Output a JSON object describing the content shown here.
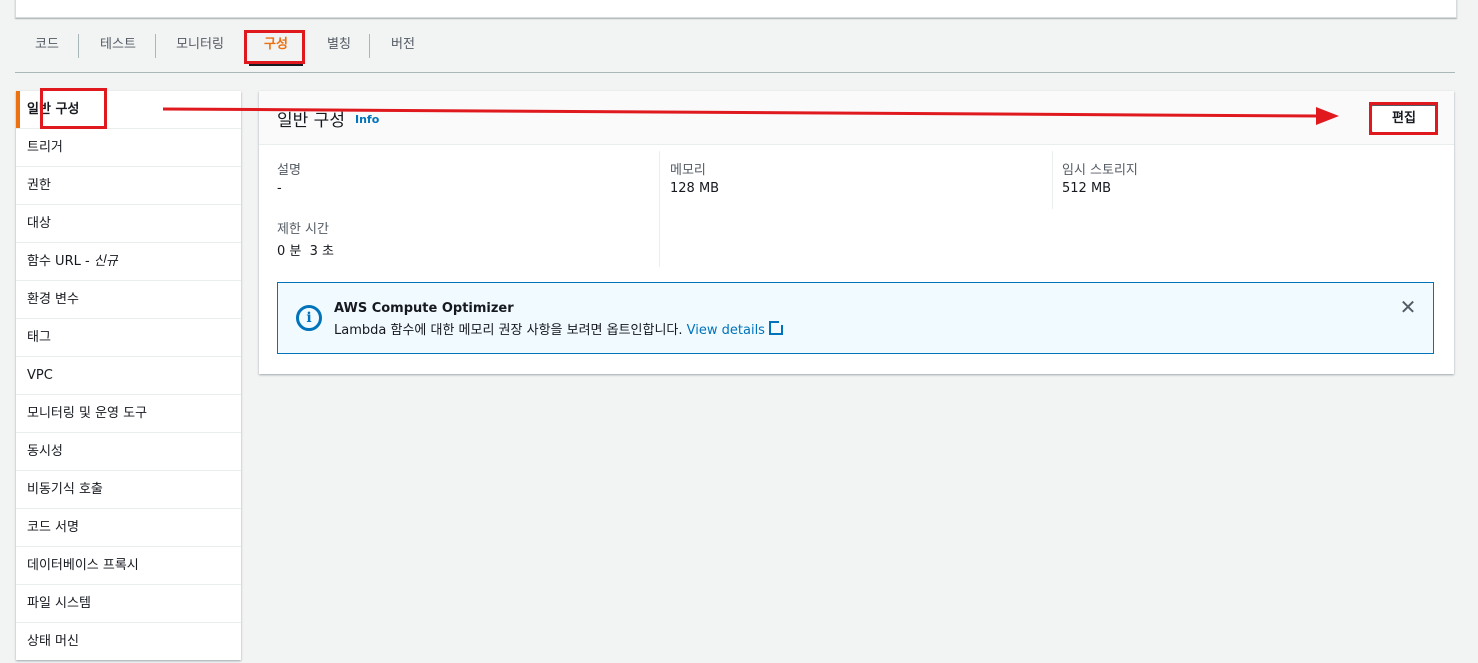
{
  "tabs": [
    {
      "label": "코드"
    },
    {
      "label": "테스트"
    },
    {
      "label": "모니터링"
    },
    {
      "label": "구성",
      "active": true
    },
    {
      "label": "별칭"
    },
    {
      "label": "버전"
    }
  ],
  "sidebar": {
    "items": [
      {
        "label": "일반 구성",
        "active": true
      },
      {
        "label": "트리거"
      },
      {
        "label": "권한"
      },
      {
        "label": "대상"
      },
      {
        "label": "함수 URL - ",
        "badge": "신규"
      },
      {
        "label": "환경 변수"
      },
      {
        "label": "태그"
      },
      {
        "label": "VPC"
      },
      {
        "label": "모니터링 및 운영 도구"
      },
      {
        "label": "동시성"
      },
      {
        "label": "비동기식 호출"
      },
      {
        "label": "코드 서명"
      },
      {
        "label": "데이터베이스 프록시"
      },
      {
        "label": "파일 시스템"
      },
      {
        "label": "상태 머신"
      }
    ]
  },
  "panel": {
    "title": "일반 구성",
    "info": "Info",
    "edit_label": "편집",
    "fields": {
      "description": {
        "label": "설명",
        "value": "-"
      },
      "memory": {
        "label": "메모리",
        "value": "128 MB"
      },
      "ephemeral_storage": {
        "label": "임시 스토리지",
        "value": "512 MB"
      },
      "timeout": {
        "label": "제한 시간",
        "value": "0 분  3 초"
      }
    },
    "alert": {
      "title": "AWS Compute Optimizer",
      "body": "Lambda 함수에 대한 메모리 권장 사항을 보려면 옵트인합니다. ",
      "link": "View details",
      "icon": "info-icon"
    }
  },
  "colors": {
    "accent": "#ec7211",
    "link": "#0073bb",
    "annotation": "#e0191f"
  }
}
